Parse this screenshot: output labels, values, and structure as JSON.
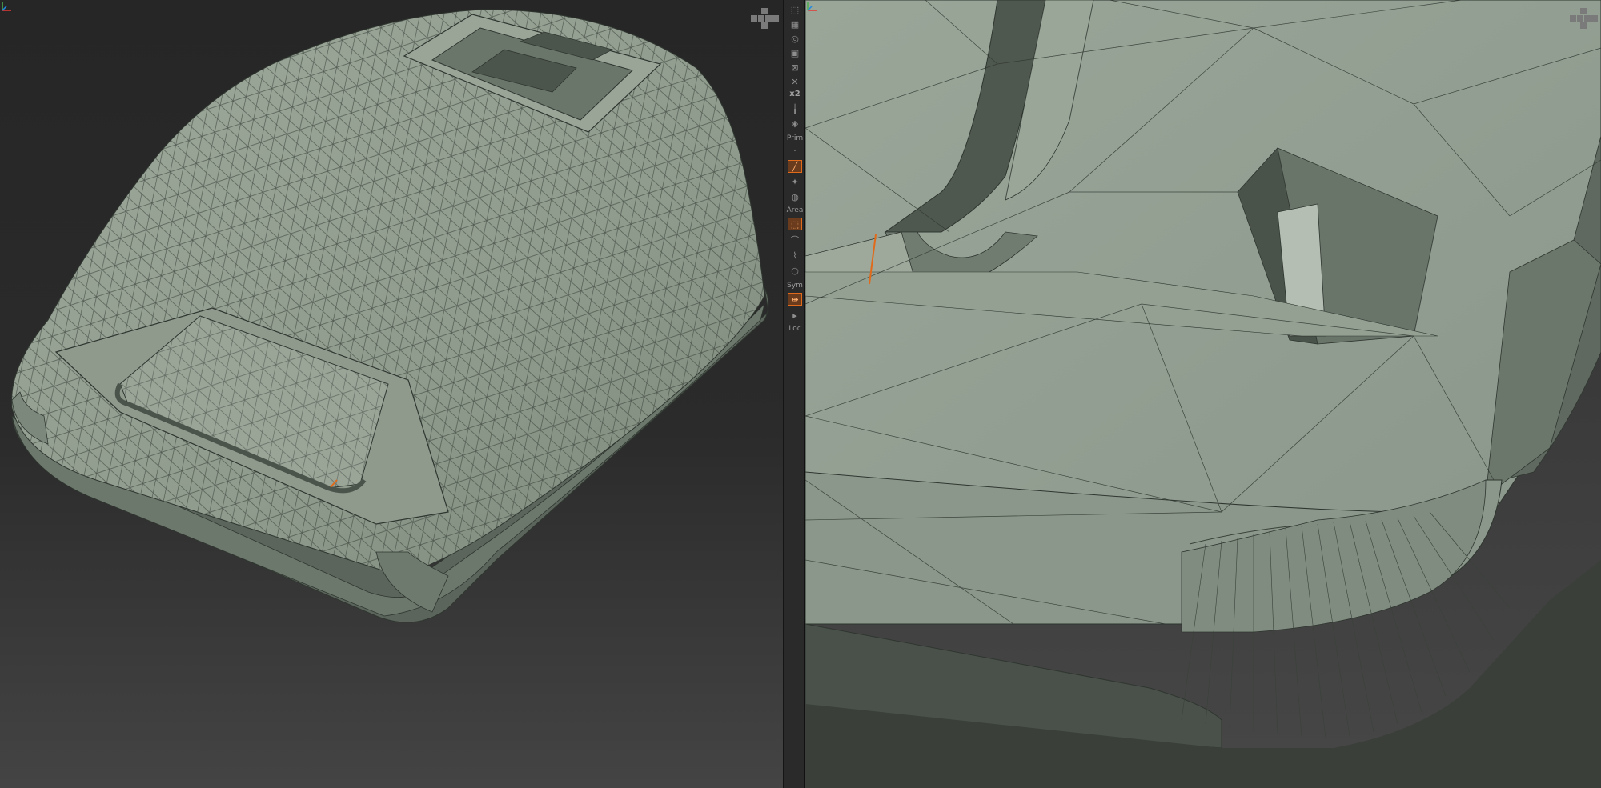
{
  "toolbar": {
    "zoom_label": "x2",
    "draw_label": "Prim",
    "area_label": "Area",
    "sym_label": "Sym",
    "loc_label": "Loc"
  },
  "icons": {
    "viewport_buttons": [
      "frame-icon",
      "move-view-icon",
      "rotate-view-icon",
      "scale-view-icon",
      "actual-size-icon"
    ],
    "tools": [
      "pointer-icon",
      "draw-stroke-icon",
      "spotlight-icon",
      "area-select-icon",
      "lasso-icon",
      "poly-select-icon",
      "circle-select-icon",
      "symmetry-icon",
      "local-symmetry-icon"
    ]
  },
  "colors": {
    "mesh_fill": "#8d9a8c",
    "mesh_shadow": "#5c665c",
    "wire": "#2f3630",
    "accent": "#e06a1a"
  }
}
